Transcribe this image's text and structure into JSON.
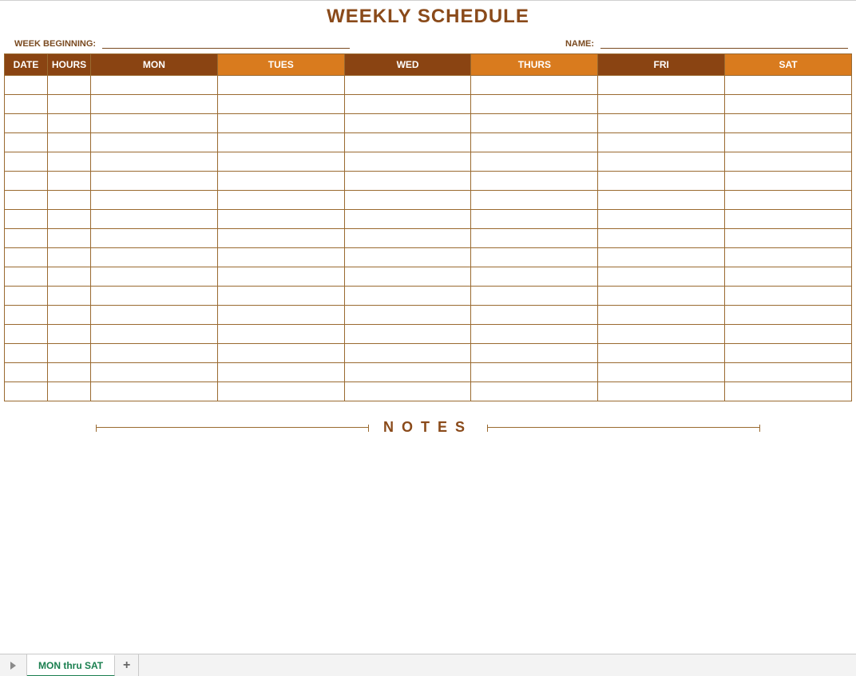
{
  "title": "WEEKLY SCHEDULE",
  "fields": {
    "week_beginning_label": "WEEK BEGINNING:",
    "name_label": "NAME:"
  },
  "columns": {
    "date": "DATE",
    "hours": "HOURS",
    "mon": "MON",
    "tues": "TUES",
    "wed": "WED",
    "thurs": "THURS",
    "fri": "FRI",
    "sat": "SAT"
  },
  "row_count": 17,
  "notes_label": "NOTES",
  "tabs": {
    "active": "MON thru SAT",
    "add": "+"
  }
}
